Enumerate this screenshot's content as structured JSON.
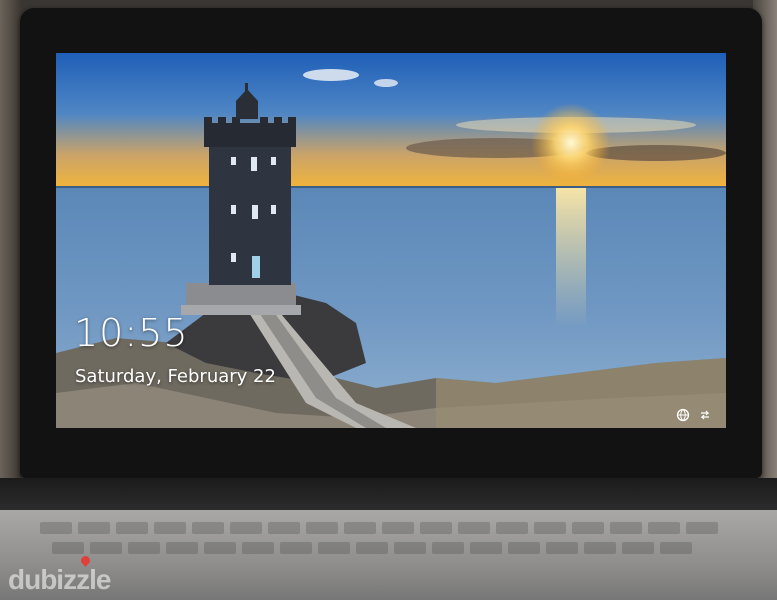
{
  "lock_screen": {
    "time": "10:55",
    "date": "Saturday, February 22"
  },
  "tray": {
    "network_icon": "globe-icon",
    "accessibility_icon": "ease-of-access-icon"
  },
  "watermark": {
    "text": "dubizzle",
    "color": "#e0403a"
  }
}
